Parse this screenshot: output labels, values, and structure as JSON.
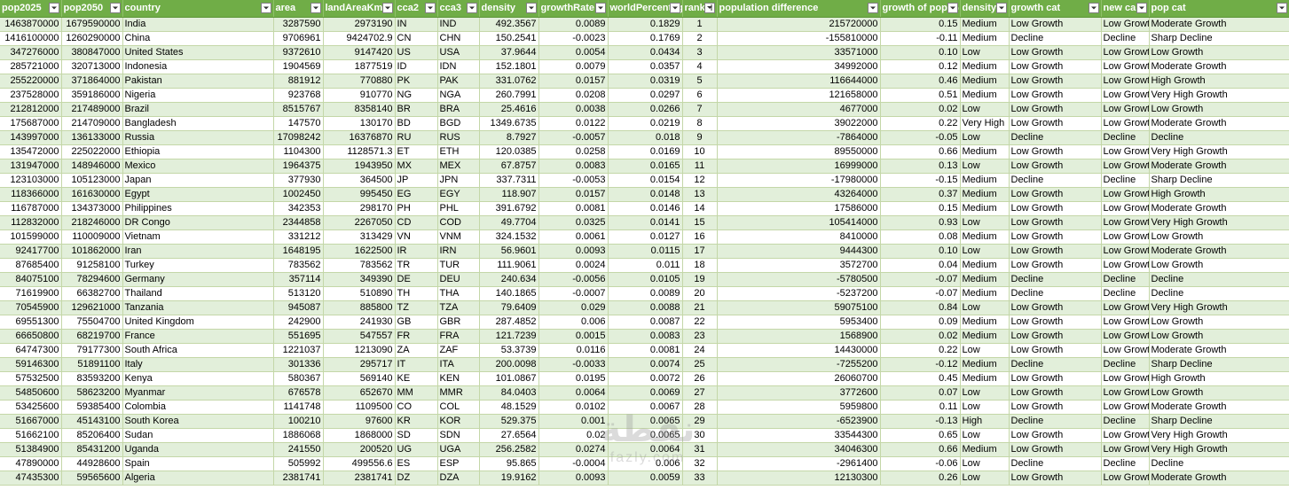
{
  "headers": [
    "pop2025",
    "pop2050",
    "country",
    "area",
    "landAreaKm",
    "cca2",
    "cca3",
    "density",
    "growthRate",
    "worldPercentage",
    "rank",
    "population difference",
    "growth of pop %",
    "density",
    "growth cat",
    "new ca",
    "pop cat"
  ],
  "sort_column_index": 10,
  "rows": [
    [
      "1463870000",
      "1679590000",
      "India",
      "3287590",
      "2973190",
      "IN",
      "IND",
      "492.3567",
      "0.0089",
      "0.1829",
      "1",
      "215720000",
      "0.15",
      "Medium",
      "Low Growth",
      "Low Growt",
      "Moderate Growth"
    ],
    [
      "1416100000",
      "1260290000",
      "China",
      "9706961",
      "9424702.9",
      "CN",
      "CHN",
      "150.2541",
      "-0.0023",
      "0.1769",
      "2",
      "-155810000",
      "-0.11",
      "Medium",
      "Decline",
      "Decline",
      "Sharp Decline"
    ],
    [
      "347276000",
      "380847000",
      "United States",
      "9372610",
      "9147420",
      "US",
      "USA",
      "37.9644",
      "0.0054",
      "0.0434",
      "3",
      "33571000",
      "0.10",
      "Low",
      "Low Growth",
      "Low Growt",
      "Low Growth"
    ],
    [
      "285721000",
      "320713000",
      "Indonesia",
      "1904569",
      "1877519",
      "ID",
      "IDN",
      "152.1801",
      "0.0079",
      "0.0357",
      "4",
      "34992000",
      "0.12",
      "Medium",
      "Low Growth",
      "Low Growt",
      "Moderate Growth"
    ],
    [
      "255220000",
      "371864000",
      "Pakistan",
      "881912",
      "770880",
      "PK",
      "PAK",
      "331.0762",
      "0.0157",
      "0.0319",
      "5",
      "116644000",
      "0.46",
      "Medium",
      "Low Growth",
      "Low Growt",
      "High Growth"
    ],
    [
      "237528000",
      "359186000",
      "Nigeria",
      "923768",
      "910770",
      "NG",
      "NGA",
      "260.7991",
      "0.0208",
      "0.0297",
      "6",
      "121658000",
      "0.51",
      "Medium",
      "Low Growth",
      "Low Growt",
      "Very High Growth"
    ],
    [
      "212812000",
      "217489000",
      "Brazil",
      "8515767",
      "8358140",
      "BR",
      "BRA",
      "25.4616",
      "0.0038",
      "0.0266",
      "7",
      "4677000",
      "0.02",
      "Low",
      "Low Growth",
      "Low Growt",
      "Low Growth"
    ],
    [
      "175687000",
      "214709000",
      "Bangladesh",
      "147570",
      "130170",
      "BD",
      "BGD",
      "1349.6735",
      "0.0122",
      "0.0219",
      "8",
      "39022000",
      "0.22",
      "Very High",
      "Low Growth",
      "Low Growt",
      "Moderate Growth"
    ],
    [
      "143997000",
      "136133000",
      "Russia",
      "17098242",
      "16376870",
      "RU",
      "RUS",
      "8.7927",
      "-0.0057",
      "0.018",
      "9",
      "-7864000",
      "-0.05",
      "Low",
      "Decline",
      "Decline",
      "Decline"
    ],
    [
      "135472000",
      "225022000",
      "Ethiopia",
      "1104300",
      "1128571.3",
      "ET",
      "ETH",
      "120.0385",
      "0.0258",
      "0.0169",
      "10",
      "89550000",
      "0.66",
      "Medium",
      "Low Growth",
      "Low Growt",
      "Very High Growth"
    ],
    [
      "131947000",
      "148946000",
      "Mexico",
      "1964375",
      "1943950",
      "MX",
      "MEX",
      "67.8757",
      "0.0083",
      "0.0165",
      "11",
      "16999000",
      "0.13",
      "Low",
      "Low Growth",
      "Low Growt",
      "Moderate Growth"
    ],
    [
      "123103000",
      "105123000",
      "Japan",
      "377930",
      "364500",
      "JP",
      "JPN",
      "337.7311",
      "-0.0053",
      "0.0154",
      "12",
      "-17980000",
      "-0.15",
      "Medium",
      "Decline",
      "Decline",
      "Sharp Decline"
    ],
    [
      "118366000",
      "161630000",
      "Egypt",
      "1002450",
      "995450",
      "EG",
      "EGY",
      "118.907",
      "0.0157",
      "0.0148",
      "13",
      "43264000",
      "0.37",
      "Medium",
      "Low Growth",
      "Low Growt",
      "High Growth"
    ],
    [
      "116787000",
      "134373000",
      "Philippines",
      "342353",
      "298170",
      "PH",
      "PHL",
      "391.6792",
      "0.0081",
      "0.0146",
      "14",
      "17586000",
      "0.15",
      "Medium",
      "Low Growth",
      "Low Growt",
      "Moderate Growth"
    ],
    [
      "112832000",
      "218246000",
      "DR Congo",
      "2344858",
      "2267050",
      "CD",
      "COD",
      "49.7704",
      "0.0325",
      "0.0141",
      "15",
      "105414000",
      "0.93",
      "Low",
      "Low Growth",
      "Low Growt",
      "Very High Growth"
    ],
    [
      "101599000",
      "110009000",
      "Vietnam",
      "331212",
      "313429",
      "VN",
      "VNM",
      "324.1532",
      "0.0061",
      "0.0127",
      "16",
      "8410000",
      "0.08",
      "Medium",
      "Low Growth",
      "Low Growt",
      "Low Growth"
    ],
    [
      "92417700",
      "101862000",
      "Iran",
      "1648195",
      "1622500",
      "IR",
      "IRN",
      "56.9601",
      "0.0093",
      "0.0115",
      "17",
      "9444300",
      "0.10",
      "Low",
      "Low Growth",
      "Low Growt",
      "Moderate Growth"
    ],
    [
      "87685400",
      "91258100",
      "Turkey",
      "783562",
      "783562",
      "TR",
      "TUR",
      "111.9061",
      "0.0024",
      "0.011",
      "18",
      "3572700",
      "0.04",
      "Medium",
      "Low Growth",
      "Low Growt",
      "Low Growth"
    ],
    [
      "84075100",
      "78294600",
      "Germany",
      "357114",
      "349390",
      "DE",
      "DEU",
      "240.634",
      "-0.0056",
      "0.0105",
      "19",
      "-5780500",
      "-0.07",
      "Medium",
      "Decline",
      "Decline",
      "Decline"
    ],
    [
      "71619900",
      "66382700",
      "Thailand",
      "513120",
      "510890",
      "TH",
      "THA",
      "140.1865",
      "-0.0007",
      "0.0089",
      "20",
      "-5237200",
      "-0.07",
      "Medium",
      "Decline",
      "Decline",
      "Decline"
    ],
    [
      "70545900",
      "129621000",
      "Tanzania",
      "945087",
      "885800",
      "TZ",
      "TZA",
      "79.6409",
      "0.029",
      "0.0088",
      "21",
      "59075100",
      "0.84",
      "Low",
      "Low Growth",
      "Low Growt",
      "Very High Growth"
    ],
    [
      "69551300",
      "75504700",
      "United Kingdom",
      "242900",
      "241930",
      "GB",
      "GBR",
      "287.4852",
      "0.006",
      "0.0087",
      "22",
      "5953400",
      "0.09",
      "Medium",
      "Low Growth",
      "Low Growt",
      "Low Growth"
    ],
    [
      "66650800",
      "68219700",
      "France",
      "551695",
      "547557",
      "FR",
      "FRA",
      "121.7239",
      "0.0015",
      "0.0083",
      "23",
      "1568900",
      "0.02",
      "Medium",
      "Low Growth",
      "Low Growt",
      "Low Growth"
    ],
    [
      "64747300",
      "79177300",
      "South Africa",
      "1221037",
      "1213090",
      "ZA",
      "ZAF",
      "53.3739",
      "0.0116",
      "0.0081",
      "24",
      "14430000",
      "0.22",
      "Low",
      "Low Growth",
      "Low Growt",
      "Moderate Growth"
    ],
    [
      "59146300",
      "51891100",
      "Italy",
      "301336",
      "295717",
      "IT",
      "ITA",
      "200.0098",
      "-0.0033",
      "0.0074",
      "25",
      "-7255200",
      "-0.12",
      "Medium",
      "Decline",
      "Decline",
      "Sharp Decline"
    ],
    [
      "57532500",
      "83593200",
      "Kenya",
      "580367",
      "569140",
      "KE",
      "KEN",
      "101.0867",
      "0.0195",
      "0.0072",
      "26",
      "26060700",
      "0.45",
      "Medium",
      "Low Growth",
      "Low Growt",
      "High Growth"
    ],
    [
      "54850600",
      "58623200",
      "Myanmar",
      "676578",
      "652670",
      "MM",
      "MMR",
      "84.0403",
      "0.0064",
      "0.0069",
      "27",
      "3772600",
      "0.07",
      "Low",
      "Low Growth",
      "Low Growt",
      "Low Growth"
    ],
    [
      "53425600",
      "59385400",
      "Colombia",
      "1141748",
      "1109500",
      "CO",
      "COL",
      "48.1529",
      "0.0102",
      "0.0067",
      "28",
      "5959800",
      "0.11",
      "Low",
      "Low Growth",
      "Low Growt",
      "Moderate Growth"
    ],
    [
      "51667000",
      "45143100",
      "South Korea",
      "100210",
      "97600",
      "KR",
      "KOR",
      "529.375",
      "0.001",
      "0.0065",
      "29",
      "-6523900",
      "-0.13",
      "High",
      "Decline",
      "Decline",
      "Sharp Decline"
    ],
    [
      "51662100",
      "85206400",
      "Sudan",
      "1886068",
      "1868000",
      "SD",
      "SDN",
      "27.6564",
      "0.02",
      "0.0065",
      "30",
      "33544300",
      "0.65",
      "Low",
      "Low Growth",
      "Low Growt",
      "Very High Growth"
    ],
    [
      "51384900",
      "85431200",
      "Uganda",
      "241550",
      "200520",
      "UG",
      "UGA",
      "256.2582",
      "0.0274",
      "0.0064",
      "31",
      "34046300",
      "0.66",
      "Medium",
      "Low Growth",
      "Low Growt",
      "Very High Growth"
    ],
    [
      "47890000",
      "44928600",
      "Spain",
      "505992",
      "499556.6",
      "ES",
      "ESP",
      "95.865",
      "-0.0004",
      "0.006",
      "32",
      "-2961400",
      "-0.06",
      "Low",
      "Decline",
      "Decline",
      "Decline"
    ],
    [
      "47435300",
      "59565600",
      "Algeria",
      "2381741",
      "2381741",
      "DZ",
      "DZA",
      "19.9162",
      "0.0093",
      "0.0059",
      "33",
      "12130300",
      "0.26",
      "Low",
      "Low Growth",
      "Low Growt",
      "Moderate Growth"
    ]
  ],
  "watermark": {
    "main": "نقطة",
    "sub": "fazly.com"
  }
}
